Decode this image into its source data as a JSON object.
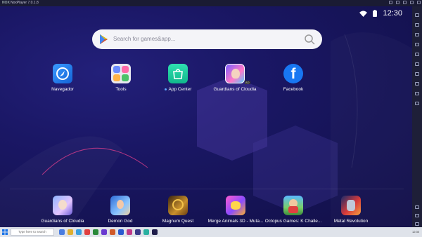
{
  "window": {
    "logo": "NOX",
    "title": "NoxPlayer 7.0.1.8"
  },
  "status_bar": {
    "time": "12:30",
    "wifi_icon": "wifi-icon",
    "battery_icon": "battery-icon"
  },
  "search": {
    "placeholder": "Search for games&app..."
  },
  "home_apps": [
    {
      "label": "Navegador",
      "icon": "browser-icon"
    },
    {
      "label": "Tools",
      "icon": "tools-folder-icon"
    },
    {
      "label": "App Center",
      "icon": "app-center-icon"
    },
    {
      "label": "Guardians of Cloudia",
      "icon": "game-icon",
      "badge": "AD"
    },
    {
      "label": "Facebook",
      "icon": "facebook-icon"
    }
  ],
  "dock_apps": [
    {
      "label": "Guardians of Cloudia"
    },
    {
      "label": "Demon God"
    },
    {
      "label": "Magnum Quest"
    },
    {
      "label": "Merge Animals 3D - Muta..."
    },
    {
      "label": "Octopus Games: K Challe..."
    },
    {
      "label": "Metal Revolution"
    }
  ],
  "taskbar": {
    "search_placeholder": "Type here to search",
    "clock": "12:30"
  },
  "colors": {
    "wallpaper": "#151354",
    "titlebar": "#1a1b33",
    "sidebar": "#1e1f38",
    "search_bg": "#f4f4f8",
    "taskbar": "#dfe3ea"
  }
}
